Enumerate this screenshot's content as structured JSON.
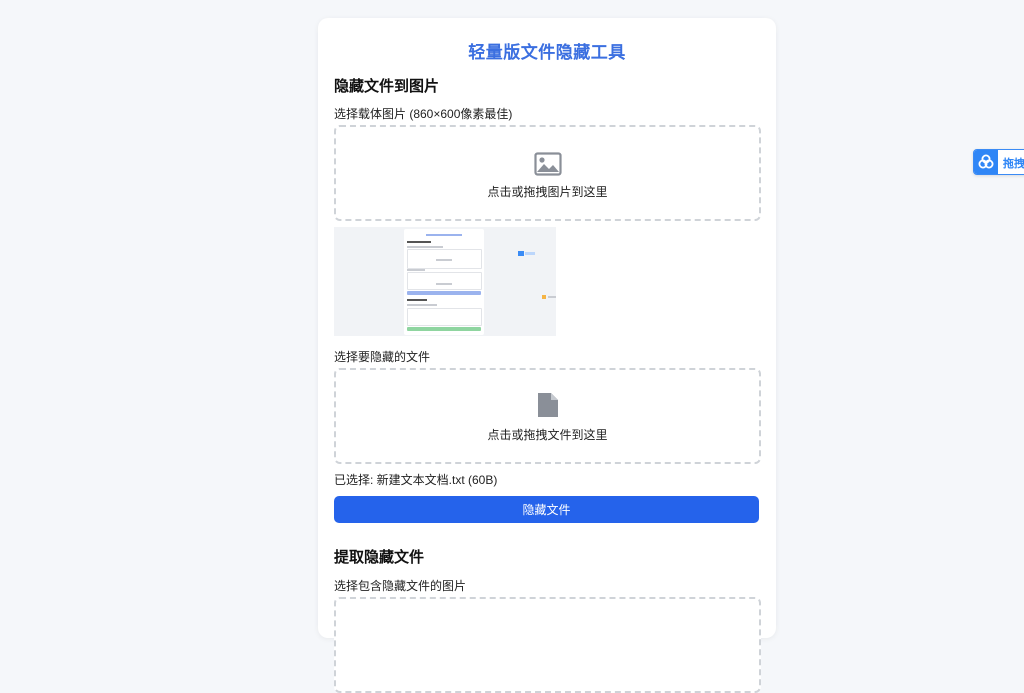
{
  "app": {
    "title": "轻量版文件隐藏工具"
  },
  "hide_section": {
    "heading": "隐藏文件到图片",
    "carrier_label": "选择载体图片 (860×600像素最佳)",
    "image_drop_text": "点击或拖拽图片到这里",
    "file_label": "选择要隐藏的文件",
    "file_drop_text": "点击或拖拽文件到这里",
    "selected_text": "已选择: 新建文本文档.txt (60B)",
    "hide_button": "隐藏文件"
  },
  "extract_section": {
    "heading": "提取隐藏文件",
    "image_label": "选择包含隐藏文件的图片"
  },
  "float_widget": {
    "label": "拖拽宝"
  },
  "colors": {
    "accent": "#2563eb",
    "title": "#3b6fe0",
    "widget": "#2f86f6"
  },
  "icons": [
    "image-icon",
    "file-icon",
    "widget-logo-icon"
  ]
}
